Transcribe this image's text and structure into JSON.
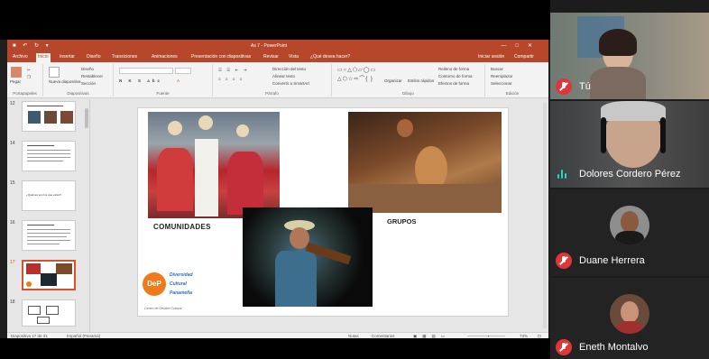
{
  "powerpoint": {
    "titlebar": {
      "title": "As 7 - PowerPoint",
      "window_controls": [
        "—",
        "□",
        "✕"
      ]
    },
    "tabs": [
      "Archivo",
      "Inicio",
      "Insertar",
      "Diseño",
      "Transiciones",
      "Animaciones",
      "Presentación con diapositivas",
      "Revisar",
      "Vista",
      "¿Qué desea hacer?"
    ],
    "active_tab": "Inicio",
    "tab_right": [
      "Iniciar sesión",
      "Compartir"
    ],
    "ribbon": {
      "groups": [
        "Portapapeles",
        "Diapositivas",
        "Fuente",
        "Párrafo",
        "Dibujo",
        "Edición"
      ],
      "paste": "Pegar",
      "new_slide": "Nueva diapositiva",
      "slide_options": [
        "Diseño",
        "Restablecer",
        "Sección"
      ],
      "drawing_options": [
        "Organizar",
        "Estilos rápidos"
      ],
      "fill_options": [
        "Relleno de forma",
        "Contorno de forma",
        "Efectos de forma"
      ],
      "edit_options": [
        "Buscar",
        "Reemplazar",
        "Seleccionar"
      ],
      "paragraph_options": [
        "Dirección del texto",
        "Alinear texto",
        "Convertir a SmartArt"
      ]
    },
    "thumbnails": [
      {
        "num": "12"
      },
      {
        "num": "14"
      },
      {
        "num": "15",
        "text": "¿Quiénes son los que están?"
      },
      {
        "num": "16"
      },
      {
        "num": "17"
      },
      {
        "num": "18"
      }
    ],
    "slide": {
      "label_comunidades": "COMUNIDADES",
      "label_grupos": "GRUPOS",
      "logo": {
        "initials": "DeP",
        "words": [
          "Diversidad",
          "Cultural",
          "Panameña"
        ],
        "subtitle": "Centro de Gestión Cultural",
        "brand_color": "#f07a1a",
        "text_color": "#2a6cc4"
      }
    },
    "status": {
      "slide": "Diapositiva 17 de 31",
      "language": "Español (Panamá)",
      "notes": "Notas",
      "comments": "Comentarios",
      "zoom": "73%"
    },
    "accent_color": "#b7472a"
  },
  "participants": [
    {
      "name": "Tú",
      "muted": true
    },
    {
      "name": "Dolores Cordero Pérez",
      "speaking": true
    },
    {
      "name": "Duane Herrera",
      "muted": true
    },
    {
      "name": "Eneth Montalvo",
      "muted": true
    }
  ]
}
